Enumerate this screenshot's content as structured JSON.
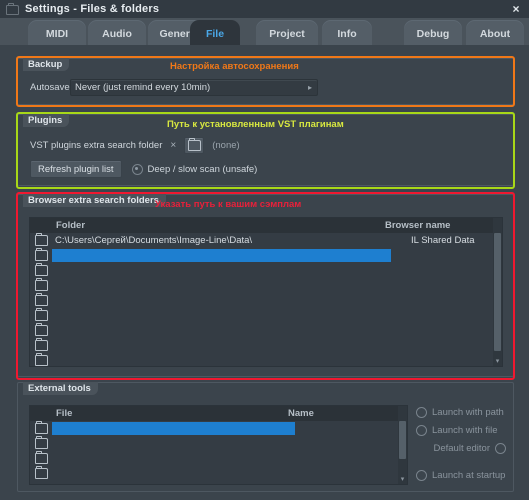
{
  "window": {
    "title": "Settings - Files & folders",
    "icon": "folder-icon",
    "close_label": "×"
  },
  "tabs": [
    {
      "label": "MIDI",
      "active": false
    },
    {
      "label": "Audio",
      "active": false
    },
    {
      "label": "General",
      "active": false
    },
    {
      "label": "File",
      "active": true
    },
    {
      "label": "Project",
      "active": false
    },
    {
      "label": "Info",
      "active": false
    },
    {
      "label": "Debug",
      "active": false
    },
    {
      "label": "About",
      "active": false
    }
  ],
  "backup": {
    "group_title": "Backup",
    "annotation": "Настройка автосохранения",
    "autosave_label": "Autosave",
    "autosave_value": "Never (just remind every 10min)",
    "autosave_arrow": "▸",
    "highlight_color": "#f07818"
  },
  "plugins": {
    "group_title": "Plugins",
    "annotation": "Путь к установленным VST плагинам",
    "vst_label": "VST plugins extra search folder",
    "clear_label": "×",
    "browse_icon": "folder-icon",
    "vst_value": "(none)",
    "refresh_label": "Refresh plugin list",
    "deep_scan_label": "Deep / slow scan (unsafe)",
    "deep_scan_on": true,
    "highlight_color": "#a8d818"
  },
  "browser_folders": {
    "group_title": "Browser extra search folders",
    "annotation": "Указать путь к вашим сэмплам",
    "highlight_color": "#f01830",
    "columns": [
      "Folder",
      "Browser name"
    ],
    "rows": [
      {
        "folder": "C:\\Users\\Сергей\\Documents\\Image-Line\\Data\\",
        "name": "IL Shared Data",
        "selected": false
      },
      {
        "folder": "",
        "name": "",
        "selected": true
      },
      {
        "folder": "",
        "name": "",
        "selected": false
      },
      {
        "folder": "",
        "name": "",
        "selected": false
      },
      {
        "folder": "",
        "name": "",
        "selected": false
      },
      {
        "folder": "",
        "name": "",
        "selected": false
      },
      {
        "folder": "",
        "name": "",
        "selected": false
      },
      {
        "folder": "",
        "name": "",
        "selected": false
      },
      {
        "folder": "",
        "name": "",
        "selected": false
      },
      {
        "folder": "",
        "name": "",
        "selected": false
      }
    ]
  },
  "external_tools": {
    "group_title": "External tools",
    "columns": [
      "File",
      "Name"
    ],
    "rows": [
      {
        "file": "",
        "name": "",
        "selected": true
      },
      {
        "file": "",
        "name": "",
        "selected": false
      },
      {
        "file": "",
        "name": "",
        "selected": false
      },
      {
        "file": "",
        "name": "",
        "selected": false
      }
    ],
    "options": [
      {
        "label": "Launch with path",
        "on": false
      },
      {
        "label": "Launch with file",
        "on": false
      }
    ],
    "default_editor_label": "Default editor",
    "default_editor_on": false,
    "launch_startup_label": "Launch at startup",
    "launch_startup_on": false
  }
}
